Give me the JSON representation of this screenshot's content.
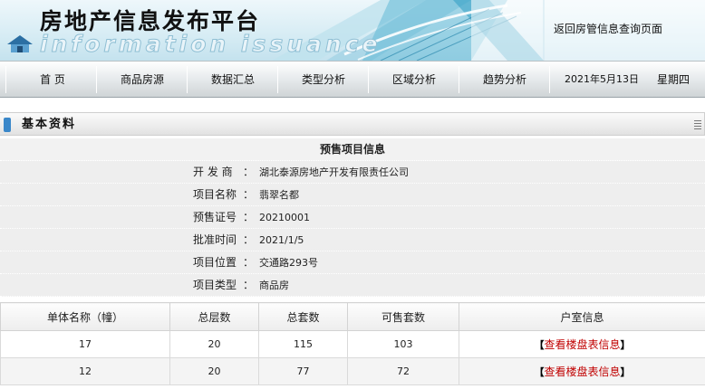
{
  "header": {
    "title": "房地产信息发布平台",
    "subtitle": "information issuance",
    "return_link": "返回房管信息查询页面"
  },
  "nav": {
    "items": [
      "首 页",
      "商品房源",
      "数据汇总",
      "类型分析",
      "区域分析",
      "趋势分析"
    ],
    "date": "2021年5月13日",
    "weekday": "星期四"
  },
  "section": {
    "title": "基本资料"
  },
  "project": {
    "heading": "预售项目信息",
    "fields": [
      {
        "label": "开 发 商",
        "value": "湖北泰源房地产开发有限责任公司"
      },
      {
        "label": "项目名称",
        "value": "翡翠名都"
      },
      {
        "label": "预售证号",
        "value": "20210001"
      },
      {
        "label": "批准时间",
        "value": "2021/1/5"
      },
      {
        "label": "项目位置",
        "value": "交通路293号"
      },
      {
        "label": "项目类型",
        "value": "商品房"
      }
    ]
  },
  "buildings": {
    "columns": [
      "单体名称（幢）",
      "总层数",
      "总套数",
      "可售套数",
      "户室信息"
    ],
    "bracket_open": "【",
    "bracket_close": "】",
    "rows": [
      {
        "name": "17",
        "floors": "20",
        "total": "115",
        "available": "103",
        "link": "查看楼盘表信息"
      },
      {
        "name": "12",
        "floors": "20",
        "total": "77",
        "available": "72",
        "link": "查看楼盘表信息"
      }
    ]
  },
  "colors": {
    "accent": "#3a87c9",
    "link": "#c00000",
    "banner": "#d6ecf4"
  }
}
